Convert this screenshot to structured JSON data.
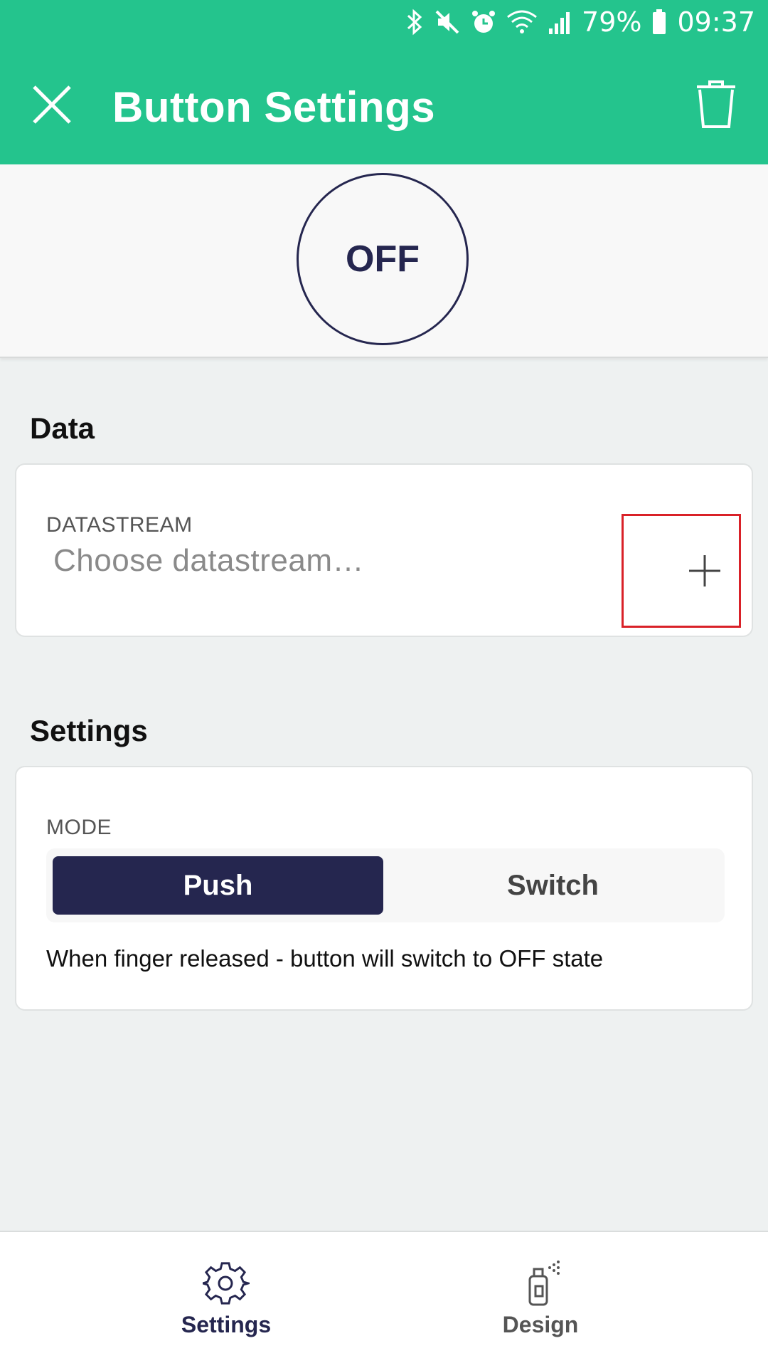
{
  "status_bar": {
    "battery_percent": "79%",
    "time": "09:37",
    "icons": [
      "bluetooth-icon",
      "mute-icon",
      "alarm-icon",
      "wifi-icon",
      "signal-icon",
      "battery-icon"
    ]
  },
  "app_bar": {
    "title": "Button Settings",
    "close_icon": "close-icon",
    "delete_icon": "trash-icon",
    "background_color": "#24c48d"
  },
  "preview": {
    "button_state": "OFF"
  },
  "data_section": {
    "title": "Data",
    "datastream_label": "DATASTREAM",
    "datastream_placeholder": "Choose datastream…",
    "add_icon": "plus-icon"
  },
  "settings_section": {
    "title": "Settings",
    "mode_label": "MODE",
    "mode_options": [
      "Push",
      "Switch"
    ],
    "selected_mode": "Push",
    "mode_hint": "When finger released - button will switch to OFF state"
  },
  "bottom_nav": {
    "items": [
      {
        "label": "Settings",
        "icon": "gear-icon",
        "active": true
      },
      {
        "label": "Design",
        "icon": "spray-can-icon",
        "active": false
      }
    ]
  },
  "colors": {
    "accent": "#24c48d",
    "primary_dark": "#25264f",
    "highlight_box": "#d92128"
  }
}
